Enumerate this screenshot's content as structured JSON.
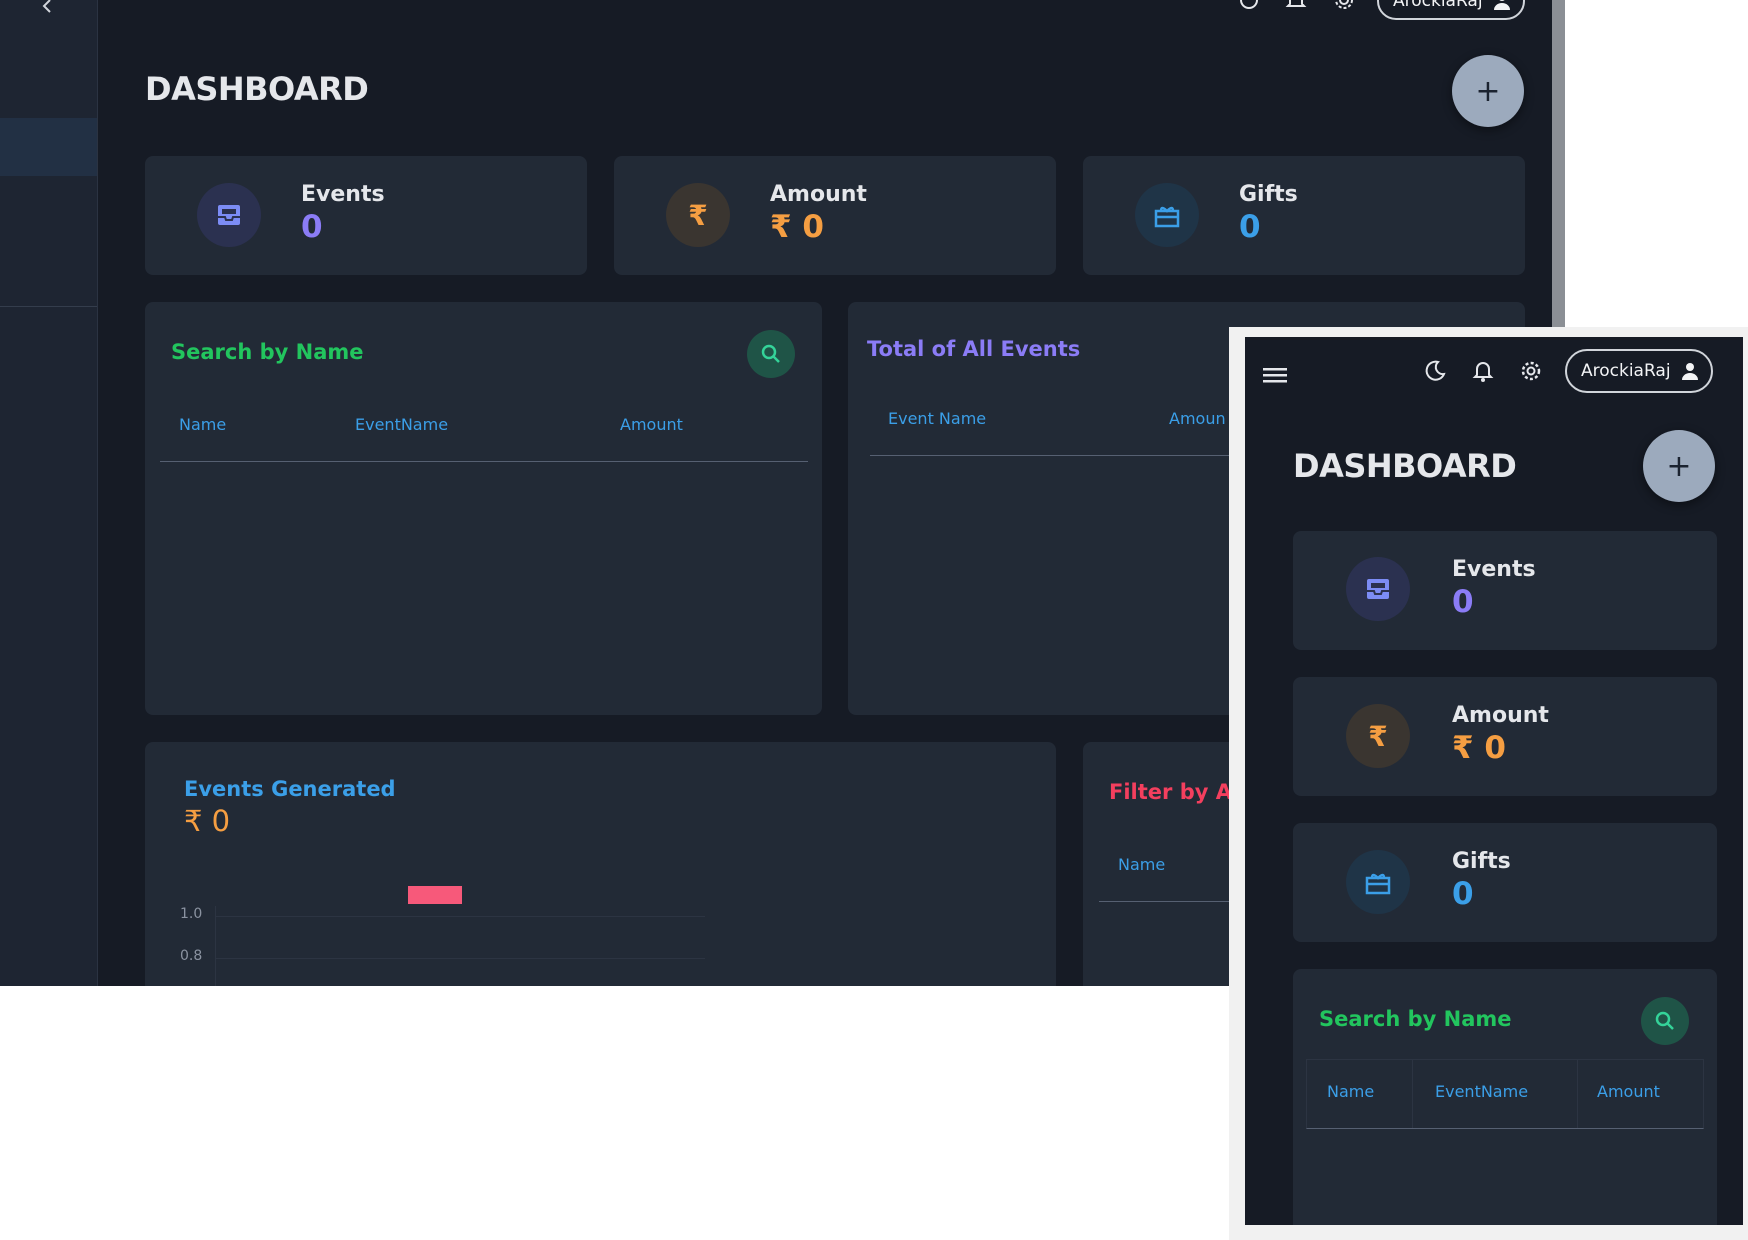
{
  "app": {
    "page_title": "DASHBOARD",
    "user_name": "ArockiaRaj"
  },
  "colors": {
    "background": "#161b25",
    "card": "#222a36",
    "events": "#8b7cf6",
    "amount": "#f59e42",
    "gifts": "#3b9fe8",
    "search_title": "#22c55e",
    "events_total_title": "#8b7cf6",
    "events_generated_title": "#3b9fe8",
    "filter_title": "#f43f5e",
    "fab": "#9caabd"
  },
  "icons": [
    "chevron-left-icon",
    "moon-icon",
    "bell-icon",
    "gear-icon",
    "user-icon",
    "menu-icon",
    "plus-icon",
    "inbox-icon",
    "rupee-icon",
    "gift-icon",
    "search-icon"
  ],
  "stats": {
    "events": {
      "label": "Events",
      "value": "0"
    },
    "amount": {
      "label": "Amount",
      "value": "₹ 0"
    },
    "gifts": {
      "label": "Gifts",
      "value": "0"
    }
  },
  "search_panel": {
    "title": "Search by Name",
    "columns": [
      "Name",
      "EventName",
      "Amount"
    ]
  },
  "total_panel": {
    "title": "Total of All Events",
    "columns": [
      "Event Name",
      "Amoun"
    ]
  },
  "events_generated": {
    "title": "Events Generated",
    "value": "₹ 0"
  },
  "filter_panel": {
    "title": "Filter by Am",
    "columns": [
      "Name"
    ]
  },
  "fab_label": "+",
  "chart_data": {
    "type": "bar",
    "categories": [
      ""
    ],
    "series": [
      {
        "values": [
          0
        ],
        "color": "#f7597a"
      }
    ],
    "yticks": [
      "1.0",
      "0.8"
    ],
    "grid": true,
    "legend": "top"
  }
}
